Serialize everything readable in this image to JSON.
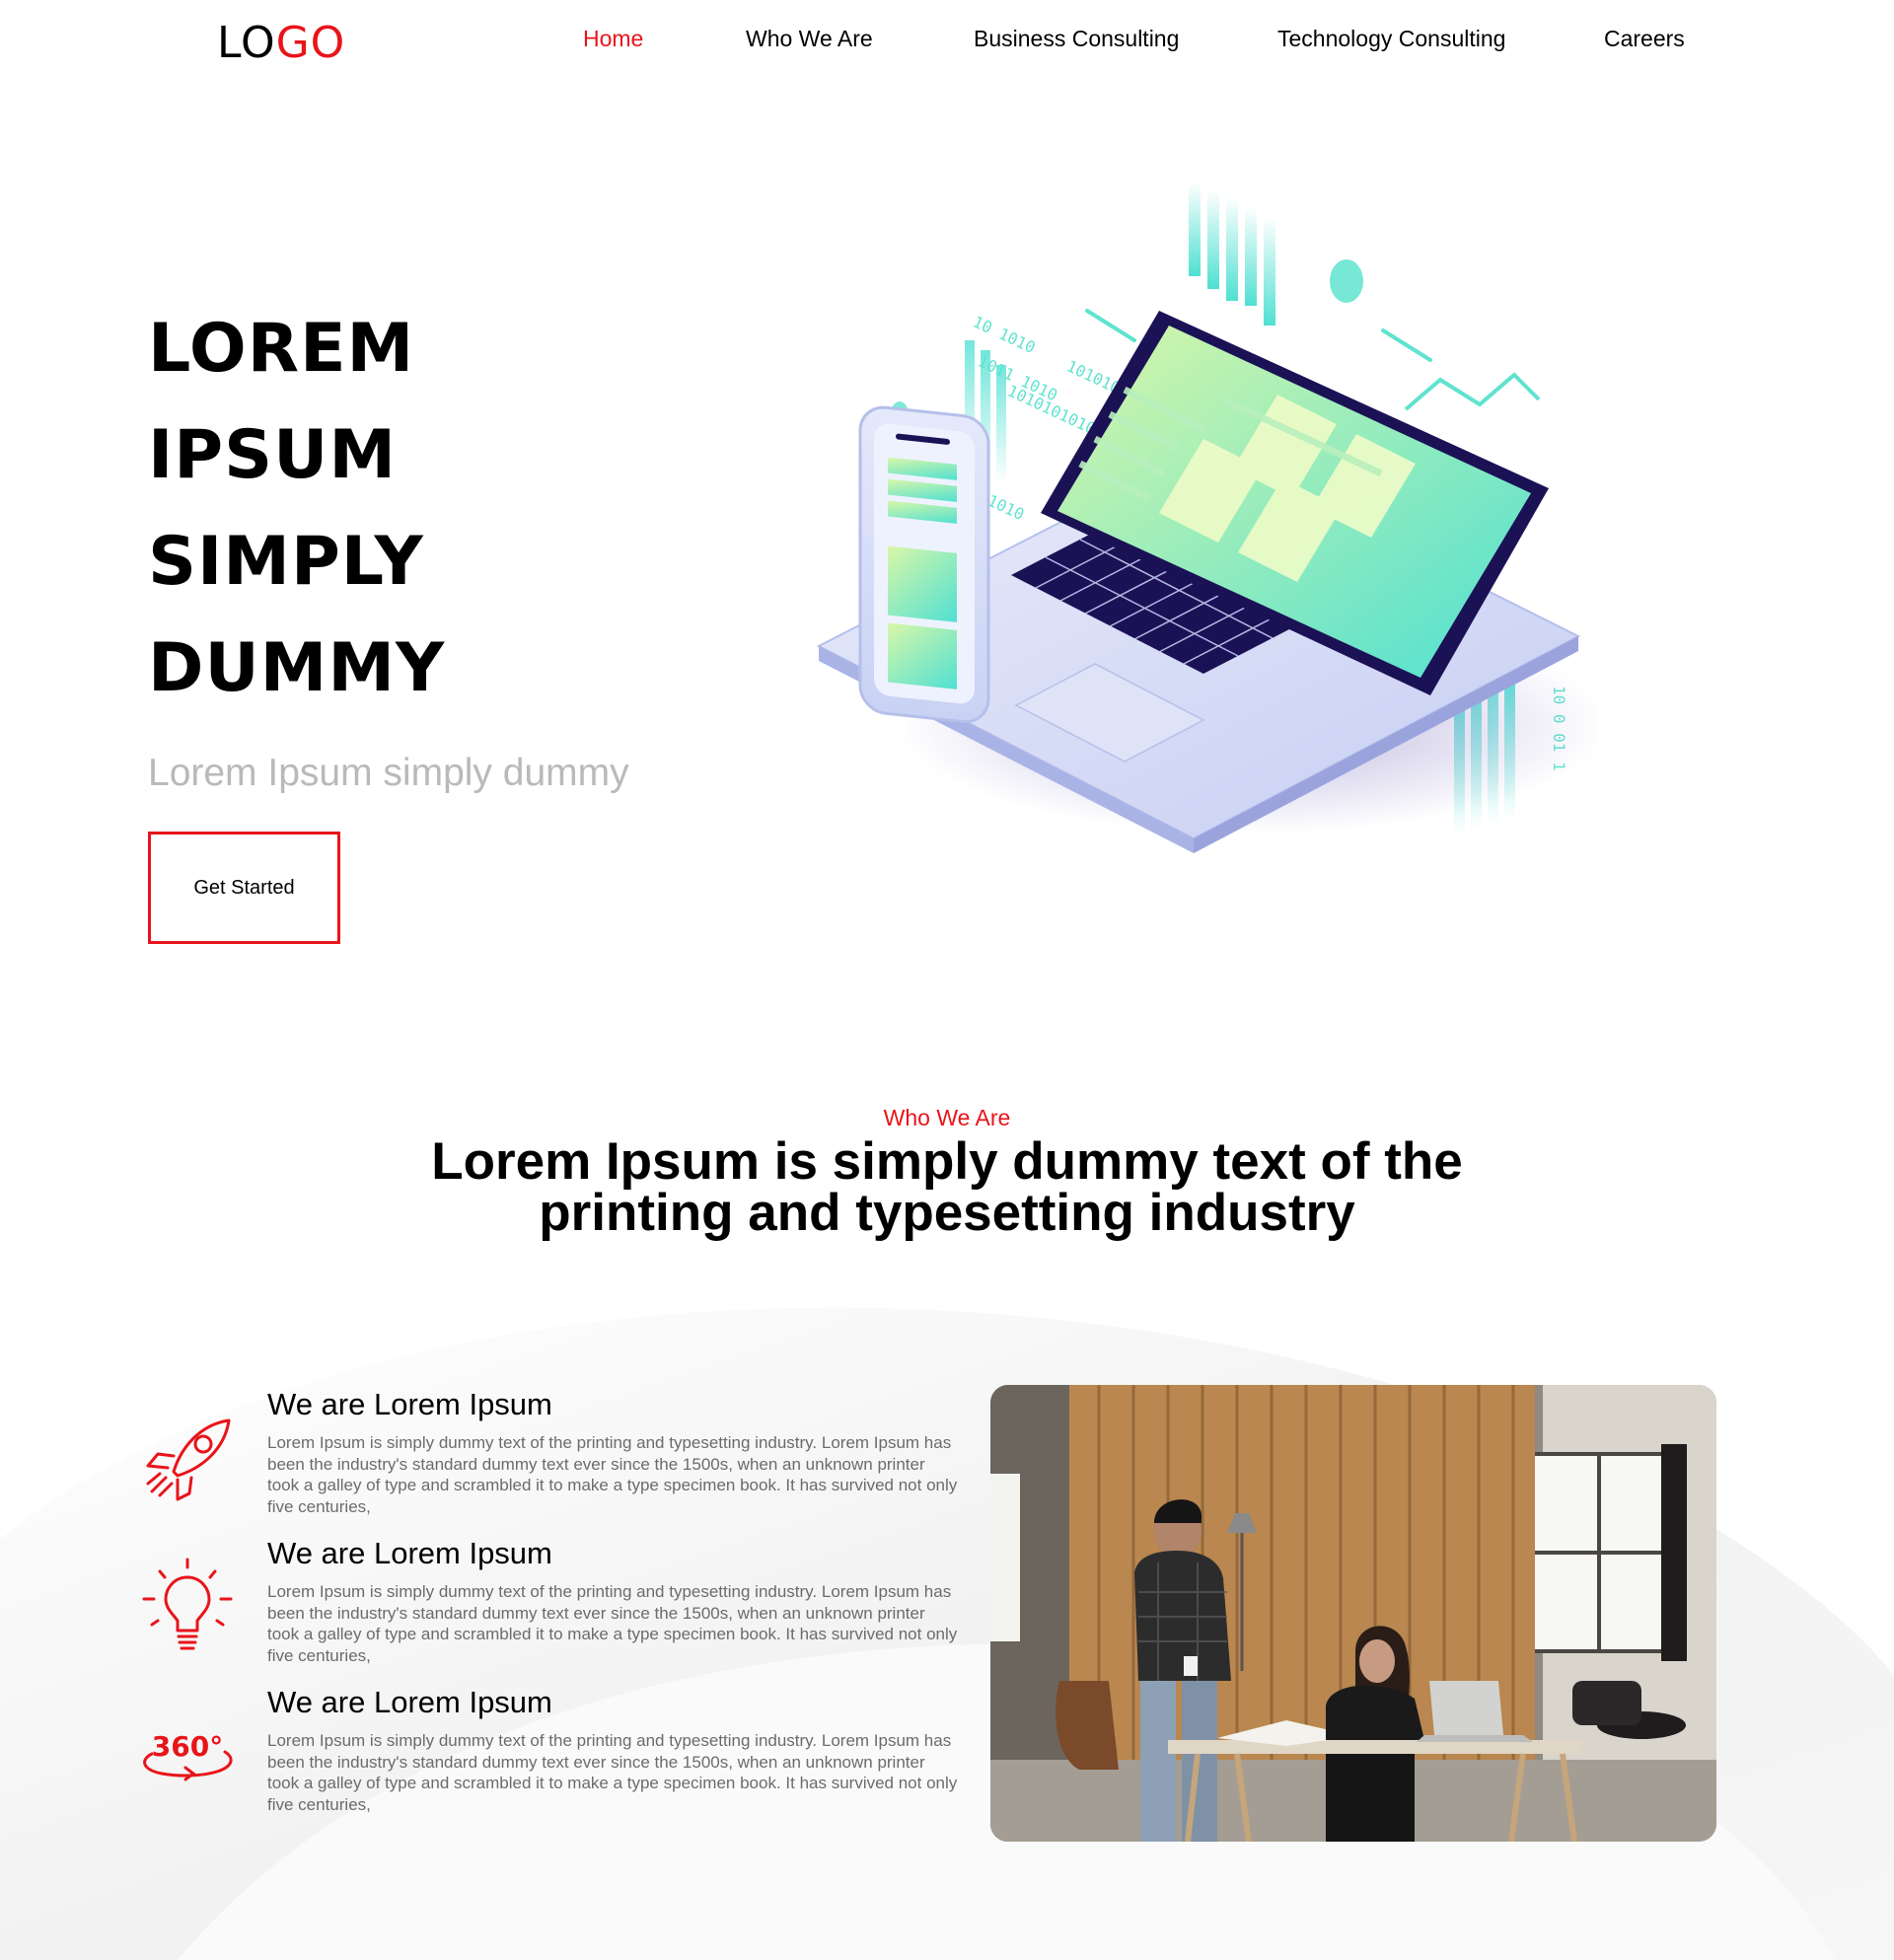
{
  "nav": {
    "logo_part1": "LO",
    "logo_part2": "GO",
    "items": [
      {
        "label": "Home",
        "active": true
      },
      {
        "label": "Who We Are",
        "active": false
      },
      {
        "label": "Business Consulting",
        "active": false
      },
      {
        "label": "Technology Consulting",
        "active": false
      },
      {
        "label": "Careers",
        "active": false
      }
    ]
  },
  "hero": {
    "title_lines": [
      "LOREM",
      "IPSUM",
      "SIMPLY",
      "DUMMY"
    ],
    "subtitle": "Lorem Ipsum simply dummy",
    "cta_label": "Get Started"
  },
  "who": {
    "kicker": "Who We Are",
    "title": "Lorem Ipsum is simply dummy text of the printing and typesetting industry",
    "features": [
      {
        "icon": "rocket-icon",
        "heading": "We are Lorem Ipsum",
        "body": "Lorem Ipsum is simply dummy text of the printing and typesetting industry. Lorem Ipsum has been the industry's standard dummy text ever since the 1500s, when an unknown printer took a galley of type and scrambled it to make a type specimen book. It has survived not only five centuries,"
      },
      {
        "icon": "lightbulb-icon",
        "heading": "We are Lorem Ipsum",
        "body": "Lorem Ipsum is simply dummy text of the printing and typesetting industry. Lorem Ipsum has been the industry's standard dummy text ever since the 1500s, when an unknown printer took a galley of type and scrambled it to make a type specimen book. It has survived not only five centuries,"
      },
      {
        "icon": "360-icon",
        "icon_text": "360°",
        "heading": "We are Lorem Ipsum",
        "body": "Lorem Ipsum is simply dummy text of the printing and typesetting industry. Lorem Ipsum has been the industry's standard dummy text ever since the 1500s, when an unknown printer took a galley of type and scrambled it to make a type specimen book. It has survived not only five centuries,"
      }
    ]
  },
  "colors": {
    "accent": "#e8141a",
    "text": "#000000",
    "muted": "#b9b9b9",
    "body_text": "#6b6b6b",
    "illustration_teal": "#5fe3cf",
    "illustration_lime": "#d9f7a8",
    "illustration_navy": "#1b1256"
  }
}
